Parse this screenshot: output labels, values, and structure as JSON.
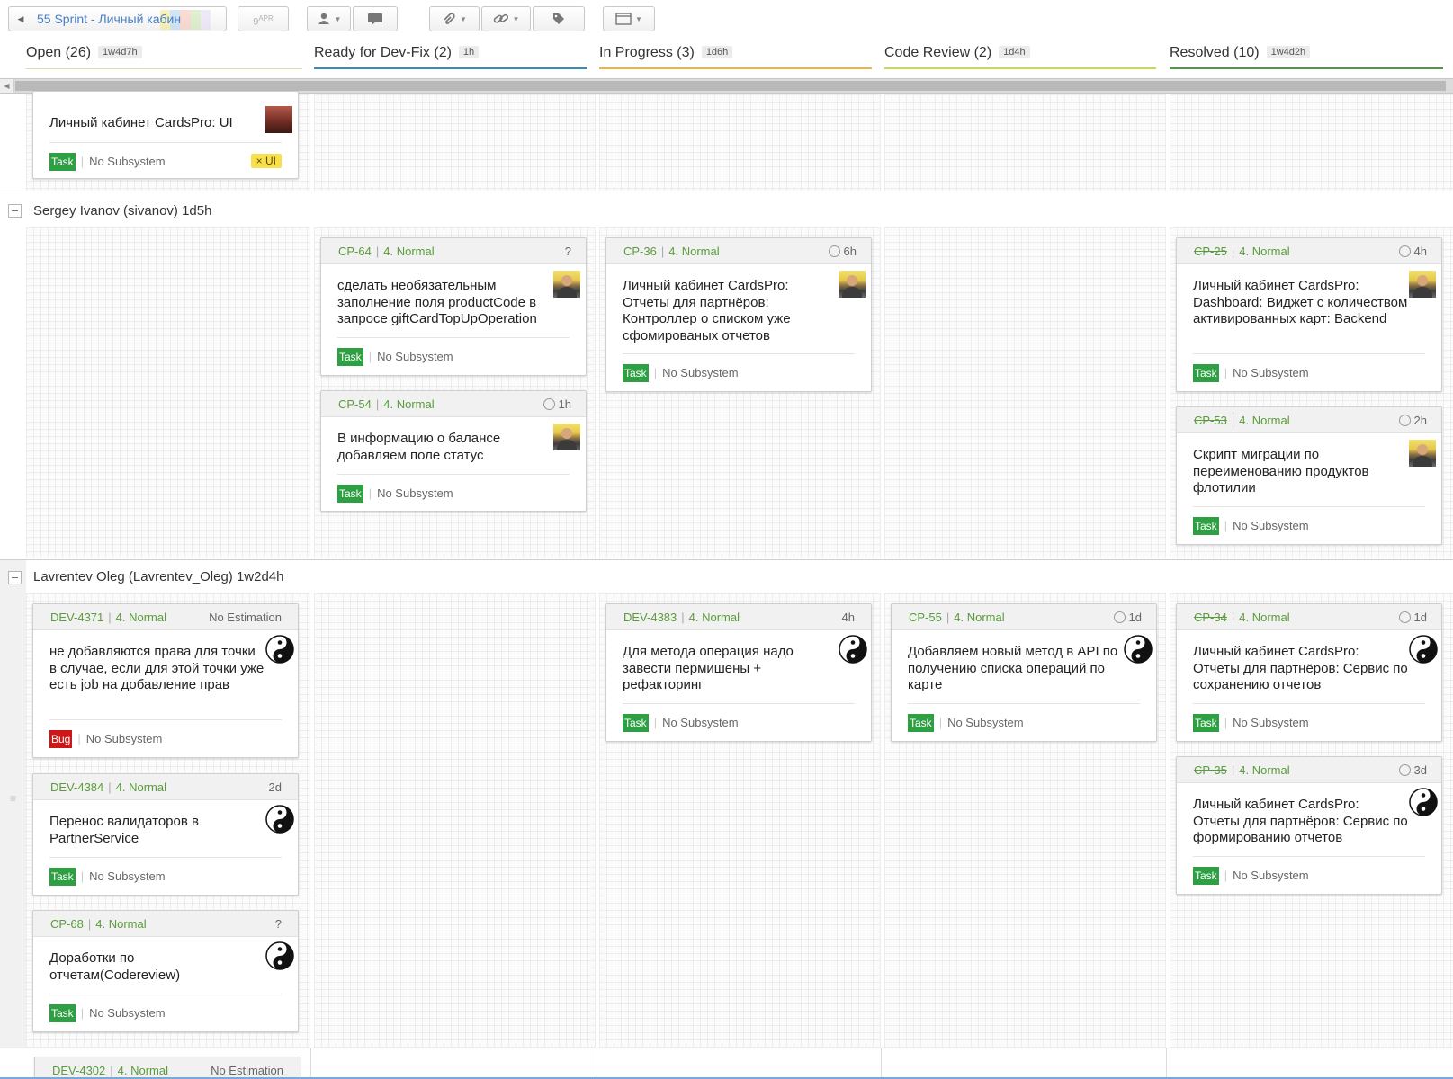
{
  "toolbar": {
    "sprint_label": "55 Sprint - Личный кабин",
    "date_label": "9",
    "date_sup": "APR"
  },
  "columns": [
    {
      "name": "Open (26)",
      "est": "1w4d7h",
      "color": "#d9e4a0"
    },
    {
      "name": "Ready for Dev-Fix (2)",
      "est": "1h",
      "color": "#2f8fb8"
    },
    {
      "name": "In Progress (3)",
      "est": "1d6h",
      "color": "#f0b43c"
    },
    {
      "name": "Code Review (2)",
      "est": "1d4h",
      "color": "#c8dc4a"
    },
    {
      "name": "Resolved (10)",
      "est": "1w4d2h",
      "color": "#4a9c3a"
    }
  ],
  "top_card": {
    "summary": "Личный кабинет CardsPro: UI",
    "type": "Task",
    "subsystem": "No Subsystem",
    "tag": "× UI"
  },
  "lanes": [
    {
      "title": "Sergey Ivanov (sivanov) 1d5h",
      "cards": [
        {
          "id": "CP-64",
          "priority": "4. Normal",
          "est": "?",
          "summary": "сделать необязательным заполнение поля productCode в запросе giftCardTopUpOperation",
          "type": "Task",
          "subsystem": "No Subsystem"
        },
        {
          "id": "CP-54",
          "priority": "4. Normal",
          "est": "1h",
          "summary": "В информацию о балансе добавляем поле статус",
          "type": "Task",
          "subsystem": "No Subsystem"
        },
        {
          "id": "CP-36",
          "priority": "4. Normal",
          "est": "6h",
          "summary": "Личный кабинет CardsPro: Отчеты для партнёров: Контроллер о списком уже сфомированых отчетов",
          "type": "Task",
          "subsystem": "No Subsystem"
        },
        {
          "id": "CP-25",
          "priority": "4. Normal",
          "est": "4h",
          "summary": "Личный кабинет CardsPro: Dashboard: Виджет с количеством активированных карт: Backend",
          "type": "Task",
          "subsystem": "No Subsystem"
        },
        {
          "id": "CP-53",
          "priority": "4. Normal",
          "est": "2h",
          "summary": "Скрипт миграции по переименованию продуктов флотилии",
          "type": "Task",
          "subsystem": "No Subsystem"
        }
      ]
    },
    {
      "title": "Lavrentev Oleg (Lavrentev_Oleg) 1w2d4h",
      "cards": [
        {
          "id": "DEV-4371",
          "priority": "4. Normal",
          "est": "No Estimation",
          "summary": "не добавляются права для точки в случае, если для этой точки уже есть job на добавление прав",
          "type": "Bug",
          "subsystem": "No Subsystem"
        },
        {
          "id": "DEV-4384",
          "priority": "4. Normal",
          "est": "2d",
          "summary": "Перенос валидаторов в PartnerService",
          "type": "Task",
          "subsystem": "No Subsystem"
        },
        {
          "id": "CP-68",
          "priority": "4. Normal",
          "est": "?",
          "summary": "Доработки по отчетам(Codereview)",
          "type": "Task",
          "subsystem": "No Subsystem"
        },
        {
          "id": "DEV-4383",
          "priority": "4. Normal",
          "est": "4h",
          "summary": "Для метода операция надо завести пермишены + рефакторинг",
          "type": "Task",
          "subsystem": "No Subsystem"
        },
        {
          "id": "CP-55",
          "priority": "4. Normal",
          "est": "1d",
          "summary": "Добавляем новый метод в API по получению списка операций по карте",
          "type": "Task",
          "subsystem": "No Subsystem"
        },
        {
          "id": "CP-34",
          "priority": "4. Normal",
          "est": "1d",
          "summary": "Личный кабинет CardsPro: Отчеты для партнёров: Сервис по сохранению отчетов",
          "type": "Task",
          "subsystem": "No Subsystem"
        },
        {
          "id": "CP-35",
          "priority": "4. Normal",
          "est": "3d",
          "summary": "Личный кабинет CardsPro: Отчеты для партнёров: Сервис по формированию отчетов",
          "type": "Task",
          "subsystem": "No Subsystem"
        }
      ]
    }
  ],
  "bottom_card": {
    "id": "DEV-4302",
    "priority": "4. Normal",
    "est": "No Estimation"
  },
  "icons": {
    "user": "user-icon",
    "comment": "comment-icon",
    "attach": "paperclip-icon",
    "link": "link-icon",
    "tag": "tag-icon",
    "view": "view-icon",
    "avatar": "avatar-icon",
    "yinyang": "yinyang-icon",
    "estimate": "circle-icon"
  }
}
